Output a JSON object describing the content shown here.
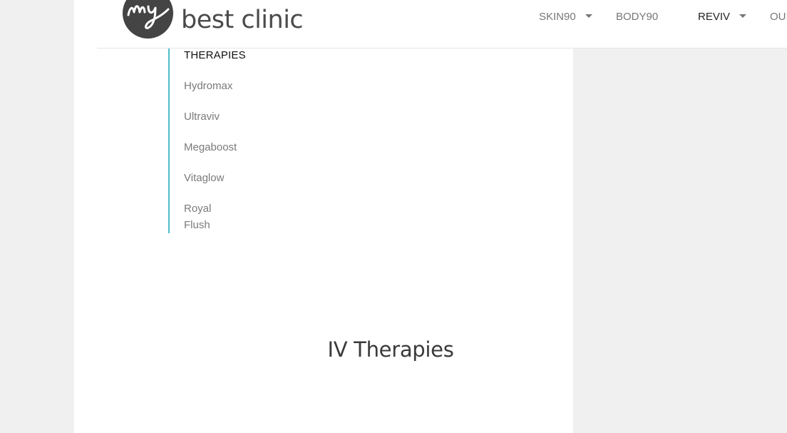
{
  "brand": {
    "logo_text": "best clinic",
    "logo_icon": "my-script-logo-icon",
    "logo_color": "#444444"
  },
  "nav": {
    "items": [
      {
        "label": "SKIN90",
        "has_dropdown": true
      },
      {
        "label": "BODY90",
        "has_dropdown": false
      },
      {
        "label": "REVIV",
        "has_dropdown": true,
        "active": true
      },
      {
        "label": "OUI",
        "has_dropdown": false
      }
    ]
  },
  "sidenav": {
    "title": "THERAPIES",
    "accent_color": "#4dbdcb",
    "items": [
      {
        "label": "Hydromax"
      },
      {
        "label": "Ultraviv"
      },
      {
        "label": "Megaboost"
      },
      {
        "label": "Vitaglow"
      },
      {
        "label": "Royal Flush"
      }
    ]
  },
  "main": {
    "heading": "IV Therapies"
  }
}
